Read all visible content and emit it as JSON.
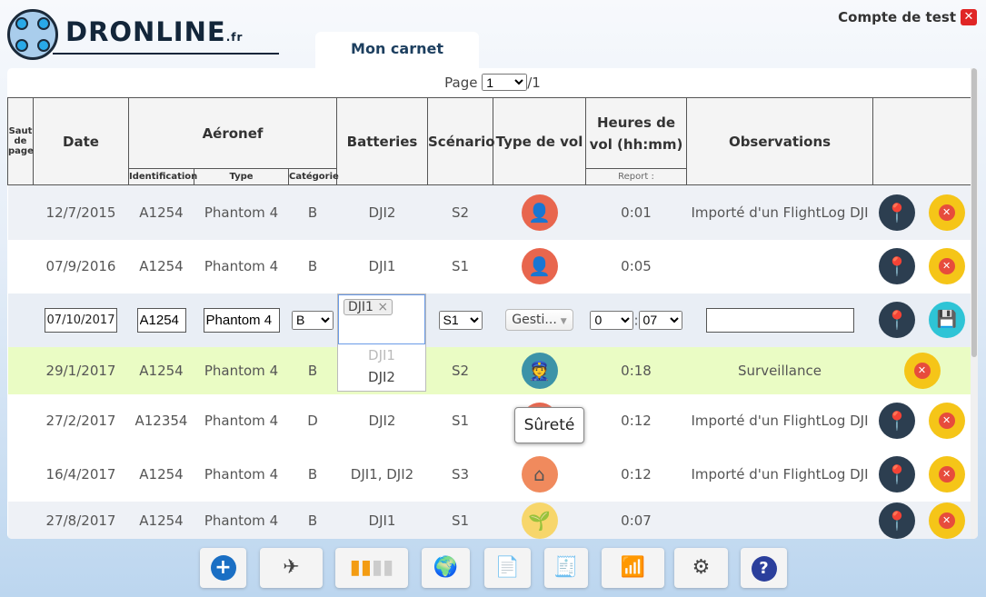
{
  "brand": {
    "name": "DRONLINE",
    "tld": ".fr"
  },
  "account": {
    "label": "Compte de test",
    "close": "✕"
  },
  "tab": "Mon carnet",
  "pager": {
    "label": "Page",
    "current": "1",
    "total": "/1"
  },
  "headers": {
    "saut": "Saut de page",
    "date": "Date",
    "aeronef": "Aéronef",
    "identification": "Identification",
    "type": "Type",
    "categorie": "Catégorie",
    "batteries": "Batteries",
    "scenario": "Scénario",
    "type_vol": "Type de vol",
    "heures": "Heures de vol (hh:mm)",
    "report": "Report :",
    "observations": "Observations"
  },
  "rows": [
    {
      "date": "12/7/2015",
      "id": "A1254",
      "type": "Phantom 4",
      "cat": "B",
      "bat": "DJI2",
      "scen": "S2",
      "vol_icon": "pilot-avatar-icon",
      "hours": "0:01",
      "obs": "Importé d'un FlightLog DJI"
    },
    {
      "date": "07/9/2016",
      "id": "A1254",
      "type": "Phantom 4",
      "cat": "B",
      "bat": "DJI1",
      "scen": "S1",
      "vol_icon": "pilot-avatar-icon",
      "hours": "0:05",
      "obs": ""
    },
    {
      "edit": true,
      "date": "07/10/2017",
      "id": "A1254",
      "type": "Phantom 4",
      "cat": "B",
      "bat": "DJI1",
      "scen": "S1",
      "vol": "Gesti...",
      "hh": "0",
      "mm": "07",
      "obs": ""
    },
    {
      "date": "29/1/2017",
      "id": "A1254",
      "type": "Phantom 4",
      "cat": "B",
      "bat": "",
      "scen": "S2",
      "vol_icon": "police-officer-icon",
      "hours": "0:18",
      "obs": "Surveillance",
      "highlight": true
    },
    {
      "date": "27/2/2017",
      "id": "A12354",
      "type": "Phantom 4",
      "cat": "D",
      "bat": "DJI2",
      "scen": "S1",
      "vol_icon": "avatar-icon",
      "hours": "0:12",
      "obs": "Importé d'un FlightLog DJI"
    },
    {
      "date": "16/4/2017",
      "id": "A1254",
      "type": "Phantom 4",
      "cat": "B",
      "bat": "DJI1, DJI2",
      "scen": "S3",
      "vol_icon": "house-icon",
      "hours": "0:12",
      "obs": "Importé d'un FlightLog DJI"
    },
    {
      "date": "27/8/2017",
      "id": "A1254",
      "type": "Phantom 4",
      "cat": "B",
      "bat": "DJI1",
      "scen": "S1",
      "vol_icon": "plant-icon",
      "hours": "0:07",
      "obs": ""
    }
  ],
  "battery_dropdown": {
    "chip": "DJI1",
    "options": [
      "DJI1",
      "DJI2"
    ]
  },
  "tooltip": "Sûreté",
  "toolbar": [
    "add-icon",
    "drone-icon",
    "battery-icon",
    "globe-add-icon",
    "report-icon",
    "invoice-icon",
    "wifi-icon",
    "settings-icon",
    "help-icon"
  ],
  "colors": {
    "highlight": "#eafcc4",
    "delete": "#f5c518",
    "map": "#2c3e50",
    "save": "#2ec4d6"
  }
}
